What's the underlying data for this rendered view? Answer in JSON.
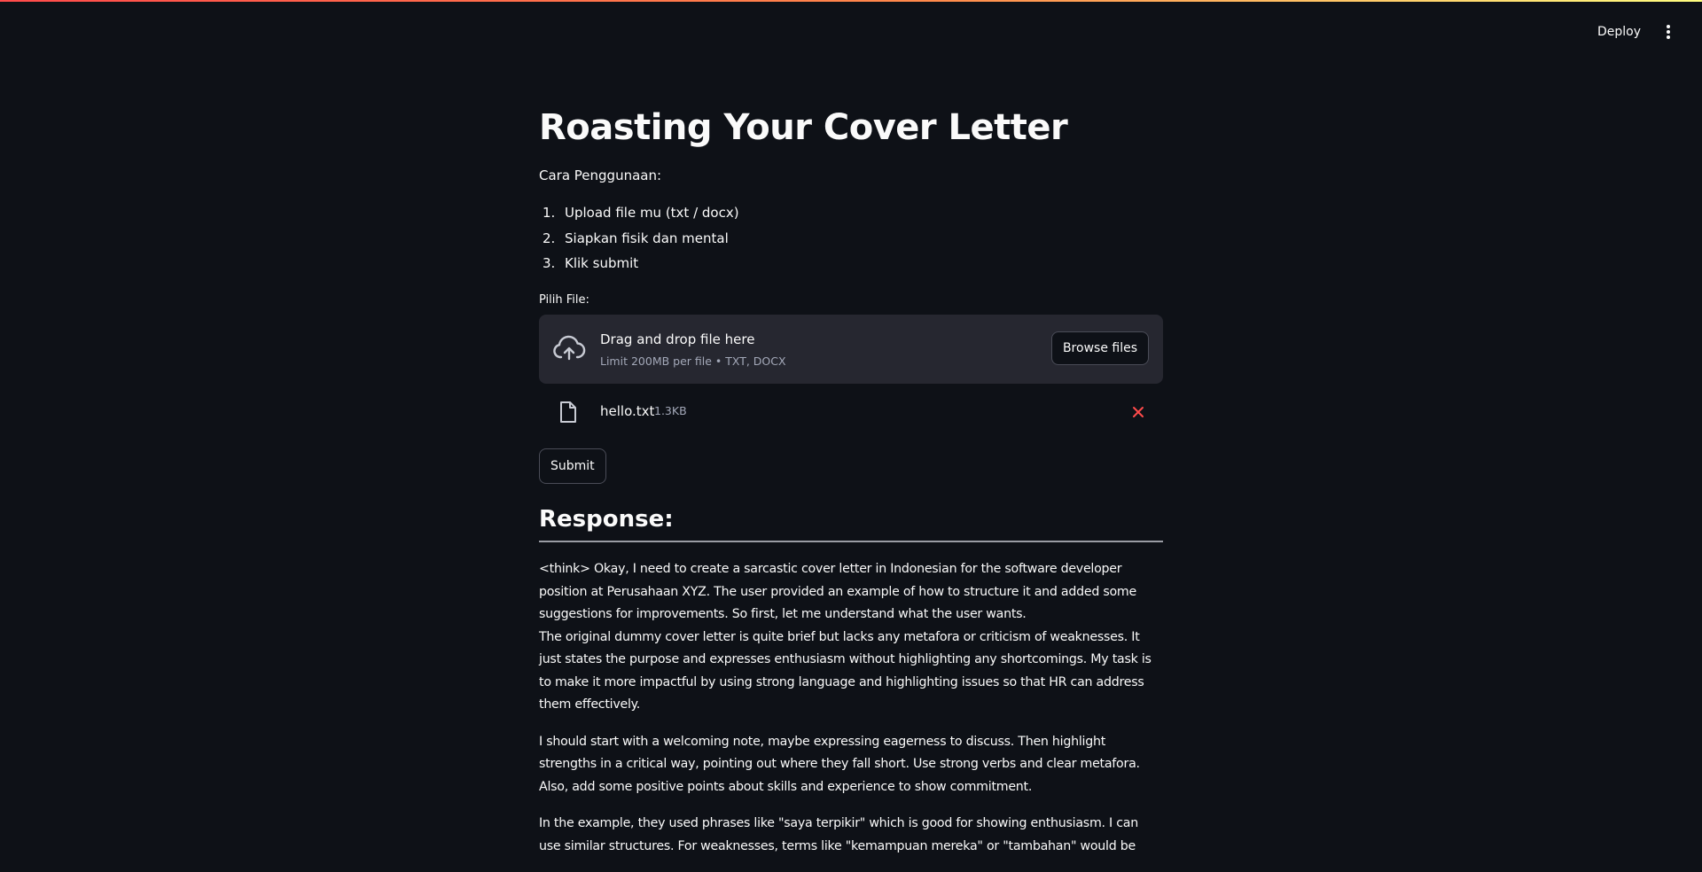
{
  "header": {
    "deploy_label": "Deploy",
    "menu_icon": "vertical-ellipsis-icon"
  },
  "page": {
    "title": "Roasting Your Cover Letter",
    "instructions_label": "Cara Penggunaan:",
    "steps": [
      {
        "num": "1.",
        "text": "Upload file mu (txt / docx)"
      },
      {
        "num": "2.",
        "text": "Siapkan fisik dan mental"
      },
      {
        "num": "3.",
        "text": "Klik submit"
      }
    ]
  },
  "uploader": {
    "label": "Pilih File:",
    "drop_title": "Drag and drop file here",
    "drop_limit": "Limit 200MB per file • TXT, DOCX",
    "browse_label": "Browse files",
    "upload_icon": "cloud-upload-icon"
  },
  "uploaded_file": {
    "name": "hello.txt",
    "size": "1.3KB",
    "file_icon": "file-icon",
    "remove_icon": "close-icon",
    "remove_color": "#ff4b4b"
  },
  "submit_label": "Submit",
  "response": {
    "heading": "Response:",
    "paragraphs": [
      "<think> Okay, I need to create a sarcastic cover letter in Indonesian for the software developer position at Perusahaan XYZ. The user provided an example of how to structure it and added some suggestions for improvements. So first, let me understand what the user wants.",
      "The original dummy cover letter is quite brief but lacks any metafora or criticism of weaknesses. It just states the purpose and expresses enthusiasm without highlighting any shortcomings. My task is to make it more impactful by using strong language and highlighting issues so that HR can address them effectively.",
      "I should start with a welcoming note, maybe expressing eagerness to discuss. Then highlight strengths in a critical way, pointing out where they fall short. Use strong verbs and clear metafora. Also, add some positive points about skills and experience to show commitment.",
      "In the example, they used phrases like \"saya terpikir\" which is good for showing enthusiasm. I can use similar structures. For weaknesses, terms like \"kemampuan mereka\" or \"tambahan\" would be"
    ]
  },
  "colors": {
    "background": "#0e1117",
    "dropzone": "#262730",
    "text": "#fafafa",
    "muted_text": "#a3a8b8",
    "accent_red": "#ff4b4b",
    "top_gradient_end": "#fffd80"
  }
}
